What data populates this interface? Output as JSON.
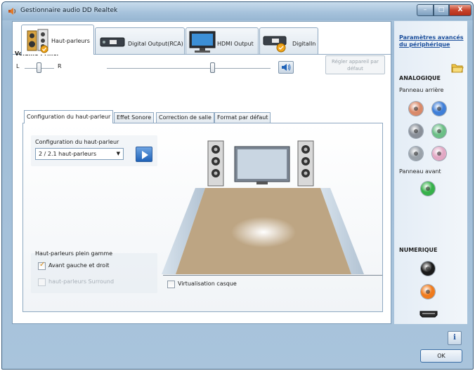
{
  "window": {
    "title": "Gestionnaire audio DD Realtek",
    "minimize_glyph": "–",
    "maximize_glyph": "□",
    "close_glyph": "X"
  },
  "device_tabs": [
    {
      "label": "Haut-parleurs",
      "icon": "speakers-icon",
      "active": true
    },
    {
      "label": "Digital Output(RCA)",
      "icon": "rca-digital-icon",
      "active": false
    },
    {
      "label": "HDMI Output",
      "icon": "monitor-icon",
      "active": false
    },
    {
      "label": "DigitalIn",
      "icon": "digital-in-icon",
      "active": false
    }
  ],
  "volume": {
    "title": "Volume Princ.",
    "left_label": "L",
    "right_label": "R",
    "balance_level": 0.5,
    "master_level": 0.65,
    "reset_label": "Régler appareil par défaut"
  },
  "sub_tabs": [
    {
      "label": "Configuration du haut-parleur",
      "active": true
    },
    {
      "label": "Effet Sonore",
      "active": false
    },
    {
      "label": "Correction de salle",
      "active": false
    },
    {
      "label": "Format par défaut",
      "active": false
    }
  ],
  "speaker_config": {
    "label": "Configuration du haut-parleur",
    "selected": "2 / 2.1 haut-parleurs",
    "arrow": "▼"
  },
  "full_range": {
    "title": "Haut-parleurs plein gamme",
    "front": {
      "label": "Avant gauche et droit",
      "checked": true
    },
    "surround": {
      "label": "haut-parleurs Surround",
      "checked": false,
      "disabled": true
    }
  },
  "virtual_headphones": {
    "label": "Virtualisation casque",
    "checked": false
  },
  "sidebar": {
    "advanced_link": "Paramètres avancés du périphérique",
    "analog_title": "ANALOGIQUE",
    "rear_panel": "Panneau arrière",
    "front_panel": "Panneau avant",
    "digital_title": "NUMERIQUE",
    "rear_jacks": [
      "#d98a6a",
      "#3f7fd8",
      "#8a9099",
      "#6bbf86",
      "#9aa2aa",
      "#e2a8c4"
    ],
    "front_jack_color": "#36b14a",
    "digital_jack_colors": [
      "#1a1a1a",
      "#f07b1d"
    ]
  },
  "buttons": {
    "info": "i",
    "ok": "OK"
  },
  "colors": {
    "accent": "#1f62b8",
    "floor": "#bda583"
  }
}
